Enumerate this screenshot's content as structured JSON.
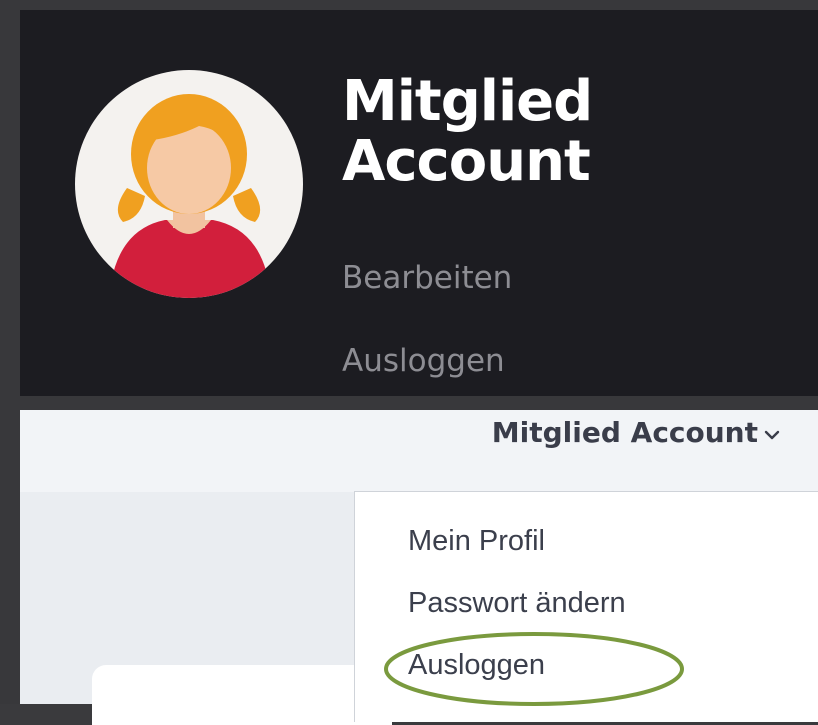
{
  "profile": {
    "title_line1": "Mitglied",
    "title_line2": "Account",
    "edit_link": "Bearbeiten",
    "logout_link": "Ausloggen"
  },
  "nav": {
    "account_label": "Mitglied Account",
    "chevron_icon": "chevron-down-icon"
  },
  "dropdown": {
    "items": [
      {
        "label": "Mein Profil"
      },
      {
        "label": "Passwort ändern"
      },
      {
        "label": "Ausloggen"
      }
    ],
    "highlighted_item": "Ausloggen"
  },
  "colors": {
    "profile_bg": "#1c1c21",
    "title": "#ffffff",
    "link_muted": "#8d8d93",
    "highlight_ring": "#7a9a3e",
    "avatar_hair": "#f0a020",
    "avatar_shirt": "#d21f3c"
  }
}
